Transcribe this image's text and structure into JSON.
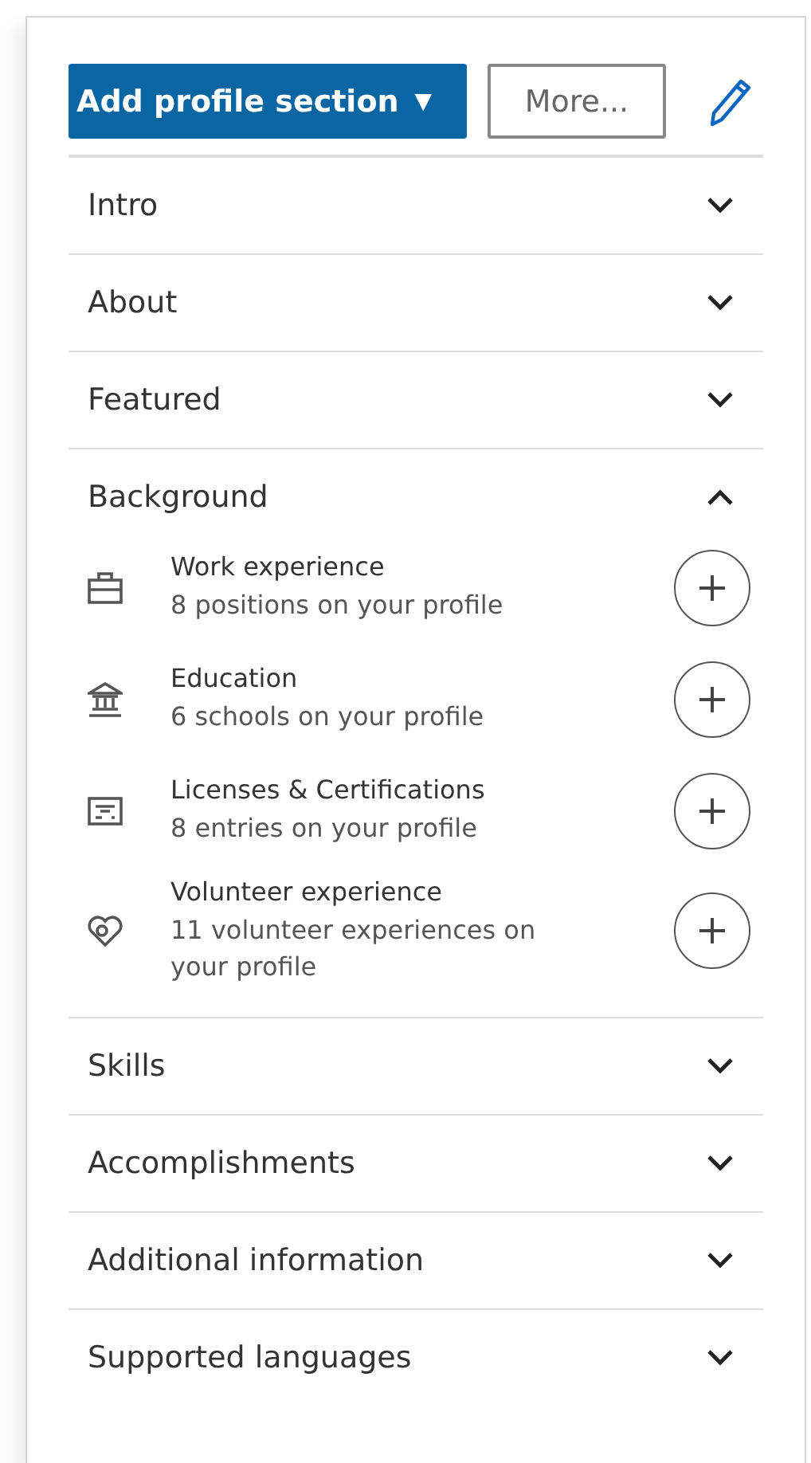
{
  "toolbar": {
    "add_button": {
      "label": "Add profile section",
      "caret": "▼"
    },
    "more_button": {
      "label": "More..."
    }
  },
  "sections": [
    {
      "title": "Intro",
      "expanded": false
    },
    {
      "title": "About",
      "expanded": false
    },
    {
      "title": "Featured",
      "expanded": false
    },
    {
      "title": "Background",
      "expanded": true,
      "items": [
        {
          "kind": "briefcase",
          "title": "Work experience",
          "subtitle": "8 positions on your profile"
        },
        {
          "kind": "school",
          "title": "Education",
          "subtitle": "6 schools on your profile"
        },
        {
          "kind": "certificate",
          "title": "Licenses & Certifications",
          "subtitle": "8 entries on your profile"
        },
        {
          "kind": "heart",
          "title": "Volunteer experience",
          "subtitle": "11 volunteer experiences on your profile"
        }
      ]
    },
    {
      "title": "Skills",
      "expanded": false
    },
    {
      "title": "Accomplishments",
      "expanded": false
    },
    {
      "title": "Additional information",
      "expanded": false
    },
    {
      "title": "Supported languages",
      "expanded": false
    }
  ]
}
